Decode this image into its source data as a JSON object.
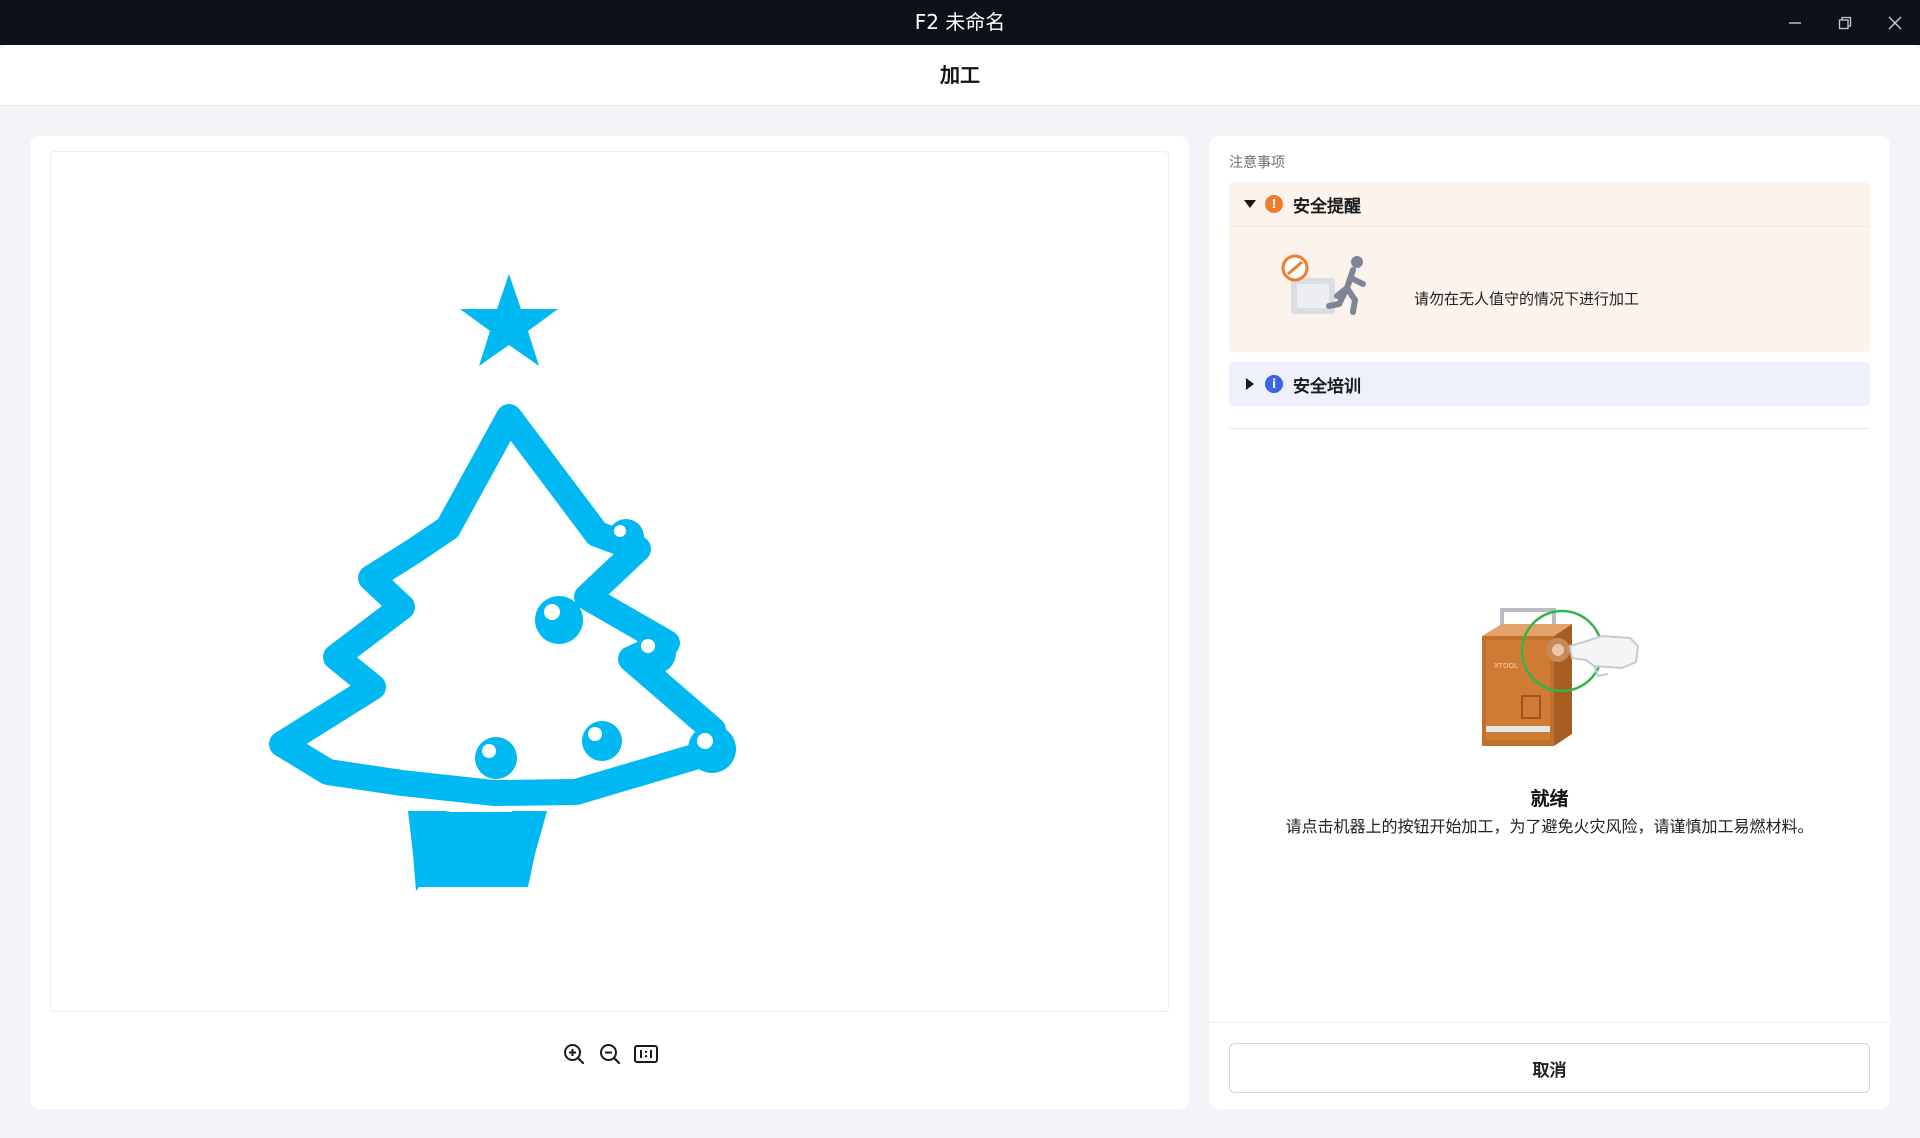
{
  "window": {
    "title": "F2 未命名"
  },
  "header": {
    "title": "加工"
  },
  "notes": {
    "section_title": "注意事项",
    "safety_reminder": {
      "label": "安全提醒",
      "expanded": true,
      "icon": "warning-icon",
      "accent": "#f07d2e",
      "message": "请勿在无人值守的情况下进行加工"
    },
    "safety_training": {
      "label": "安全培训",
      "expanded": false,
      "icon": "info-icon",
      "accent": "#3a63e8"
    }
  },
  "status": {
    "title": "就绪",
    "description": "请点击机器上的按钮开始加工，为了避免火灾风险，请谨慎加工易燃材料。"
  },
  "actions": {
    "cancel_label": "取消"
  },
  "preview": {
    "design_color": "#00b9f2",
    "machine_label": "XTOOL"
  },
  "colors": {
    "titlebar": "#0d1119",
    "background": "#f3f4f8"
  }
}
